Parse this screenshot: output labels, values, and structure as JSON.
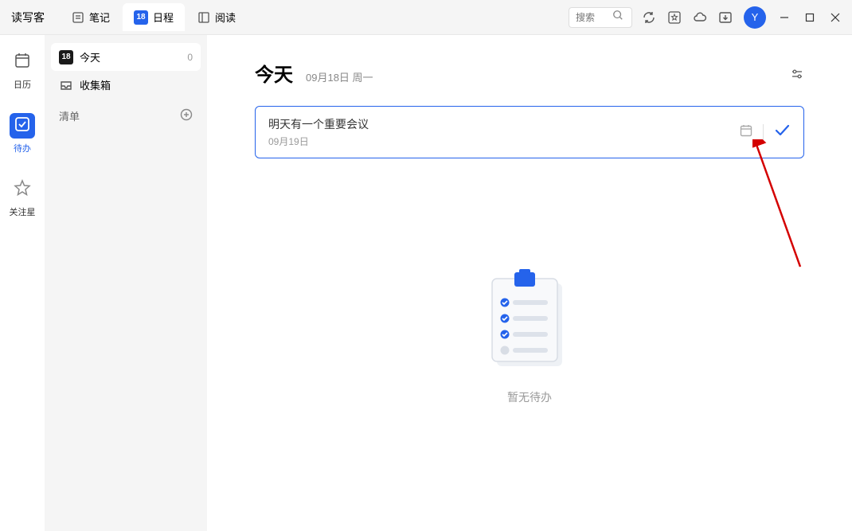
{
  "app": {
    "name": "读写客"
  },
  "tabs": [
    {
      "label": "笔记",
      "active": false
    },
    {
      "label": "日程",
      "badge": "18",
      "active": true
    },
    {
      "label": "阅读",
      "active": false
    }
  ],
  "search": {
    "placeholder": "搜索"
  },
  "avatar": {
    "initial": "Y"
  },
  "sidebar_nav": [
    {
      "label": "日历",
      "active": false
    },
    {
      "label": "待办",
      "active": true
    },
    {
      "label": "关注星",
      "active": false
    }
  ],
  "sidebar_list": {
    "items": [
      {
        "label": "今天",
        "icon_text": "18",
        "count": "0",
        "active": true
      },
      {
        "label": "收集箱",
        "active": false
      }
    ],
    "section_label": "清单"
  },
  "content": {
    "title": "今天",
    "date_label": "09月18日 周一"
  },
  "todo": {
    "title": "明天有一个重要会议",
    "date": "09月19日"
  },
  "empty": {
    "text": "暂无待办"
  }
}
